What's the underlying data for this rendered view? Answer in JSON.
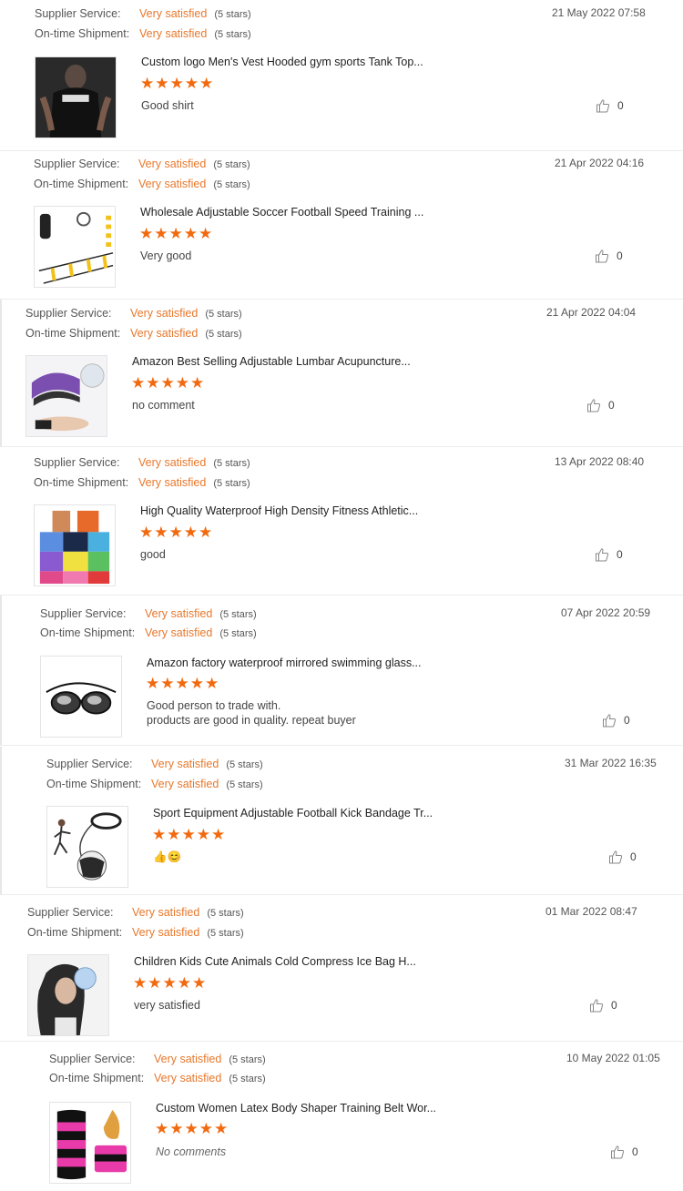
{
  "labels": {
    "supplier_service": "Supplier Service:",
    "ontime_shipment": "On-time Shipment:"
  },
  "reviews": [
    {
      "supplier_value": "Very satisfied",
      "supplier_stars": "(5 stars)",
      "shipment_value": "Very satisfied",
      "shipment_stars": "(5 stars)",
      "date": "21 May 2022 07:58",
      "product": "Custom logo Men's Vest Hooded gym sports Tank Top...",
      "rating": 5,
      "stars_text": "★★★★★",
      "comment": "Good shirt",
      "comment2": "",
      "likes": "0",
      "thumb_icon": "black-tank-top-image"
    },
    {
      "supplier_value": "Very satisfied",
      "supplier_stars": "(5 stars)",
      "shipment_value": "Very satisfied",
      "shipment_stars": "(5 stars)",
      "date": "21 Apr 2022 04:16",
      "product": "Wholesale Adjustable Soccer Football Speed Training ...",
      "rating": 5,
      "stars_text": "★★★★★",
      "comment": "Very good",
      "comment2": "",
      "likes": "0",
      "thumb_icon": "agility-ladder-image"
    },
    {
      "supplier_value": "Very satisfied",
      "supplier_stars": "(5 stars)",
      "shipment_value": "Very satisfied",
      "shipment_stars": "(5 stars)",
      "date": "21 Apr 2022 04:04",
      "product": "Amazon Best Selling Adjustable Lumbar Acupuncture...",
      "rating": 5,
      "stars_text": "★★★★★",
      "comment": "no comment",
      "comment2": "",
      "likes": "0",
      "thumb_icon": "back-stretcher-image"
    },
    {
      "supplier_value": "Very satisfied",
      "supplier_stars": "(5 stars)",
      "shipment_value": "Very satisfied",
      "shipment_stars": "(5 stars)",
      "date": "13 Apr 2022 08:40",
      "product": "High Quality Waterproof High Density Fitness Athletic...",
      "rating": 5,
      "stars_text": "★★★★★",
      "comment": "good",
      "comment2": "",
      "likes": "0",
      "thumb_icon": "athletic-tape-rolls-image"
    },
    {
      "supplier_value": "Very satisfied",
      "supplier_stars": "(5 stars)",
      "shipment_value": "Very satisfied",
      "shipment_stars": "(5 stars)",
      "date": "07 Apr 2022 20:59",
      "product": "Amazon factory waterproof mirrored swimming glass...",
      "rating": 5,
      "stars_text": "★★★★★",
      "comment": "Good person to trade with.",
      "comment2": "products are good in quality.  repeat buyer",
      "likes": "0",
      "thumb_icon": "swim-goggles-image"
    },
    {
      "supplier_value": "Very satisfied",
      "supplier_stars": "(5 stars)",
      "shipment_value": "Very satisfied",
      "shipment_stars": "(5 stars)",
      "date": "31 Mar 2022 16:35",
      "product": "Sport Equipment Adjustable Football Kick Bandage Tr...",
      "rating": 5,
      "stars_text": "★★★★★",
      "comment": "👍😊",
      "comment2": "",
      "likes": "0",
      "thumb_icon": "kick-trainer-image"
    },
    {
      "supplier_value": "Very satisfied",
      "supplier_stars": "(5 stars)",
      "shipment_value": "Very satisfied",
      "shipment_stars": "(5 stars)",
      "date": "01 Mar 2022 08:47",
      "product": "Children Kids Cute Animals Cold Compress Ice Bag H...",
      "rating": 5,
      "stars_text": "★★★★★",
      "comment": "very satisfied",
      "comment2": "",
      "likes": "0",
      "thumb_icon": "ice-bag-image"
    },
    {
      "supplier_value": "Very satisfied",
      "supplier_stars": "(5 stars)",
      "shipment_value": "Very satisfied",
      "shipment_stars": "(5 stars)",
      "date": "10 May 2022 01:05",
      "product": "Custom Women Latex Body Shaper Training Belt Wor...",
      "rating": 5,
      "stars_text": "★★★★★",
      "comment": "No comments",
      "comment2": "",
      "likes": "0",
      "thumb_icon": "waist-trainer-image"
    }
  ],
  "colors": {
    "accent": "#e8782c",
    "star": "#f26a10"
  },
  "icons": {
    "like": "thumbs-up-icon"
  }
}
